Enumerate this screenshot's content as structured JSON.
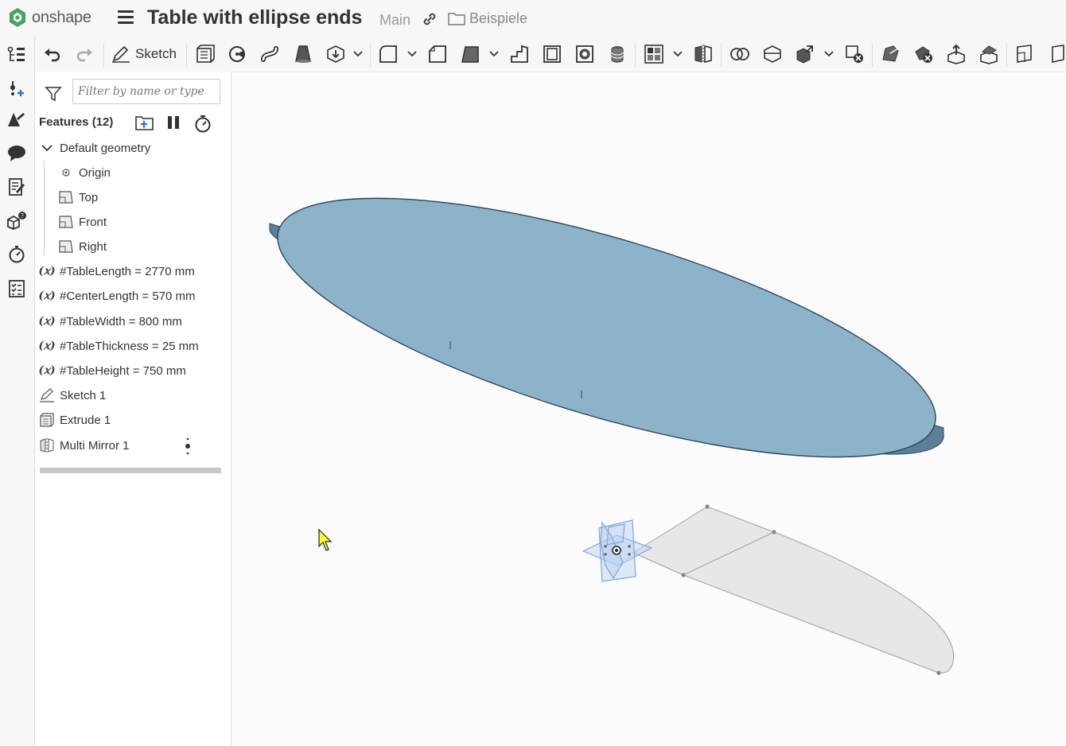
{
  "header": {
    "brand": "onshape",
    "document_title": "Table with ellipse ends",
    "workspace": "Main",
    "folder": "Beispiele"
  },
  "toolbar": {
    "sketch_label": "Sketch"
  },
  "features_panel": {
    "filter_placeholder": "Filter by name or type",
    "title": "Features (12)",
    "items": [
      {
        "label": "Default geometry",
        "type": "group"
      },
      {
        "label": "Origin",
        "type": "origin"
      },
      {
        "label": "Top",
        "type": "plane"
      },
      {
        "label": "Front",
        "type": "plane"
      },
      {
        "label": "Right",
        "type": "plane"
      },
      {
        "label": "#TableLength = 2770 mm",
        "type": "variable"
      },
      {
        "label": "#CenterLength = 570 mm",
        "type": "variable"
      },
      {
        "label": "#TableWidth = 800 mm",
        "type": "variable"
      },
      {
        "label": "#TableThickness = 25 mm",
        "type": "variable"
      },
      {
        "label": "#TableHeight = 750 mm",
        "type": "variable"
      },
      {
        "label": "Sketch 1",
        "type": "sketch"
      },
      {
        "label": "Extrude 1",
        "type": "extrude"
      },
      {
        "label": "Multi Mirror 1",
        "type": "mirror"
      }
    ],
    "variable_symbol": "(𝑥)"
  },
  "colors": {
    "tabletop_fill": "#8db3cb",
    "tabletop_edge": "#5f87a2",
    "brand_green": "#4aa564",
    "cursor_yellow": "#ffff33",
    "plane_blue": "#7aa6e0"
  }
}
